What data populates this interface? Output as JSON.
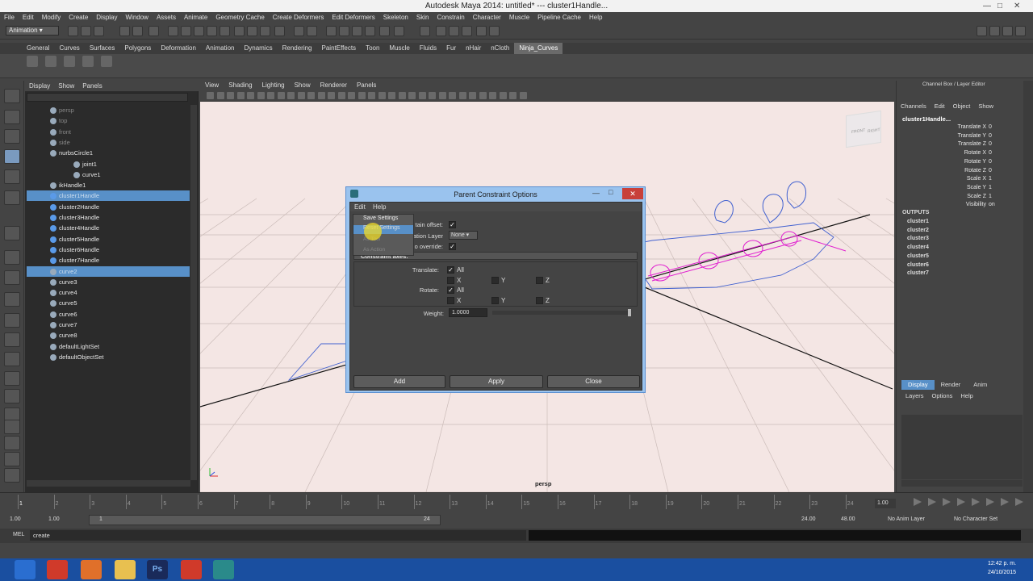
{
  "window": {
    "title": "Autodesk Maya 2014: untitled*   ---   cluster1Handle..."
  },
  "menu": [
    "File",
    "Edit",
    "Modify",
    "Create",
    "Display",
    "Window",
    "Assets",
    "Animate",
    "Geometry Cache",
    "Create Deformers",
    "Edit Deformers",
    "Skeleton",
    "Skin",
    "Constrain",
    "Character",
    "Muscle",
    "Pipeline Cache",
    "Help"
  ],
  "mode": "Animation",
  "shelf_tabs": [
    "General",
    "Curves",
    "Surfaces",
    "Polygons",
    "Deformation",
    "Animation",
    "Dynamics",
    "Rendering",
    "PaintEffects",
    "Toon",
    "Muscle",
    "Fluids",
    "Fur",
    "nHair",
    "nCloth",
    "Ninja_Curves"
  ],
  "outliner": {
    "menu": [
      "Display",
      "Show",
      "Panels"
    ],
    "rows": [
      {
        "label": "persp",
        "indent": 1,
        "dim": true,
        "sel": false
      },
      {
        "label": "top",
        "indent": 1,
        "dim": true,
        "sel": false
      },
      {
        "label": "front",
        "indent": 1,
        "dim": true,
        "sel": false
      },
      {
        "label": "side",
        "indent": 1,
        "dim": true,
        "sel": false
      },
      {
        "label": "nurbsCircle1",
        "indent": 1,
        "dim": false,
        "sel": false
      },
      {
        "label": "joint1",
        "indent": 2,
        "dim": false,
        "sel": false
      },
      {
        "label": "curve1",
        "indent": 2,
        "dim": false,
        "sel": false
      },
      {
        "label": "ikHandle1",
        "indent": 1,
        "dim": false,
        "sel": false
      },
      {
        "label": "cluster1Handle",
        "indent": 1,
        "dim": false,
        "sel": true
      },
      {
        "label": "cluster2Handle",
        "indent": 1,
        "dim": false,
        "sel": false
      },
      {
        "label": "cluster3Handle",
        "indent": 1,
        "dim": false,
        "sel": false
      },
      {
        "label": "cluster4Handle",
        "indent": 1,
        "dim": false,
        "sel": false
      },
      {
        "label": "cluster5Handle",
        "indent": 1,
        "dim": false,
        "sel": false
      },
      {
        "label": "cluster6Handle",
        "indent": 1,
        "dim": false,
        "sel": false
      },
      {
        "label": "cluster7Handle",
        "indent": 1,
        "dim": false,
        "sel": false
      },
      {
        "label": "curve2",
        "indent": 1,
        "dim": false,
        "sel": true
      },
      {
        "label": "curve3",
        "indent": 1,
        "dim": false,
        "sel": false
      },
      {
        "label": "curve4",
        "indent": 1,
        "dim": false,
        "sel": false
      },
      {
        "label": "curve5",
        "indent": 1,
        "dim": false,
        "sel": false
      },
      {
        "label": "curve6",
        "indent": 1,
        "dim": false,
        "sel": false
      },
      {
        "label": "curve7",
        "indent": 1,
        "dim": false,
        "sel": false
      },
      {
        "label": "curve8",
        "indent": 1,
        "dim": false,
        "sel": false
      },
      {
        "label": "defaultLightSet",
        "indent": 1,
        "dim": false,
        "sel": false
      },
      {
        "label": "defaultObjectSet",
        "indent": 1,
        "dim": false,
        "sel": false
      }
    ]
  },
  "viewport": {
    "menu": [
      "View",
      "Shading",
      "Lighting",
      "Show",
      "Renderer",
      "Panels"
    ],
    "camera": "persp",
    "viewcube_front": "FRONT",
    "viewcube_right": "RIGHT"
  },
  "dialog": {
    "title": "Parent Constraint Options",
    "menu": [
      "Edit",
      "Help"
    ],
    "dropdown": [
      "Save Settings",
      "Reset Settings",
      "As Tool",
      "As Action"
    ],
    "maintain_offset_label": "tain offset:",
    "anim_layer_label": "ation Layer",
    "anim_layer_value": "None",
    "override_label": "o override:",
    "constraint_axes": "Constraint axes:",
    "translate_label": "Translate:",
    "rotate_label": "Rotate:",
    "all": "All",
    "x": "X",
    "y": "Y",
    "z": "Z",
    "weight_label": "Weight:",
    "weight_value": "1.0000",
    "buttons": [
      "Add",
      "Apply",
      "Close"
    ]
  },
  "channelbox": {
    "title": "Channel Box / Layer Editor",
    "menu": [
      "Channels",
      "Edit",
      "Object",
      "Show"
    ],
    "object": "cluster1Handle...",
    "attrs": [
      {
        "name": "Translate X",
        "value": "0"
      },
      {
        "name": "Translate Y",
        "value": "0"
      },
      {
        "name": "Translate Z",
        "value": "0"
      },
      {
        "name": "Rotate X",
        "value": "0"
      },
      {
        "name": "Rotate Y",
        "value": "0"
      },
      {
        "name": "Rotate Z",
        "value": "0"
      },
      {
        "name": "Scale X",
        "value": "1"
      },
      {
        "name": "Scale Y",
        "value": "1"
      },
      {
        "name": "Scale Z",
        "value": "1"
      },
      {
        "name": "Visibility",
        "value": "on"
      }
    ],
    "outputs_label": "OUTPUTS",
    "outputs": [
      "cluster1",
      "cluster2",
      "cluster3",
      "cluster4",
      "cluster5",
      "cluster6",
      "cluster7"
    ],
    "layer_tabs": [
      "Display",
      "Render",
      "Anim"
    ],
    "layer_menu": [
      "Layers",
      "Options",
      "Help"
    ]
  },
  "timeline": {
    "ticks": [
      "1",
      "2",
      "3",
      "4",
      "5",
      "6",
      "7",
      "8",
      "9",
      "10",
      "11",
      "12",
      "13",
      "14",
      "15",
      "16",
      "17",
      "18",
      "19",
      "20",
      "21",
      "22",
      "23",
      "24"
    ],
    "current": "1.00",
    "range_start": "1.00",
    "range_start2": "1.00",
    "range_inner_start": "1",
    "range_inner_end": "24",
    "range_end": "24.00",
    "range_end2": "48.00",
    "anim_layer": "No Anim Layer",
    "char_set": "No Character Set"
  },
  "cmdline": {
    "lang": "MEL",
    "text": "create"
  },
  "taskbar": {
    "time": "12:42 p. m.",
    "date": "24/10/2015"
  },
  "colors": {
    "accent": "#5890c8",
    "viewport_bg": "#f4e6e4",
    "curve_magenta": "#e020d0",
    "curve_blue": "#4060d0",
    "taskbar": "#1a4fa0"
  }
}
